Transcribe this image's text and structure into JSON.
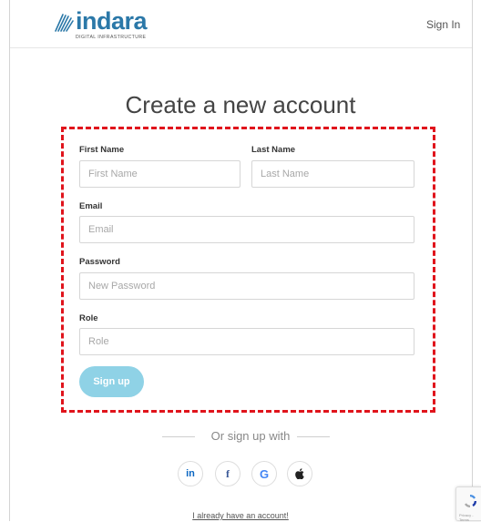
{
  "header": {
    "logo_text": "indara",
    "logo_tagline": "DIGITAL INFRASTRUCTURE",
    "sign_in_label": "Sign In"
  },
  "page": {
    "title": "Create a new account"
  },
  "form": {
    "first_name": {
      "label": "First Name",
      "placeholder": "First Name",
      "value": ""
    },
    "last_name": {
      "label": "Last Name",
      "placeholder": "Last Name",
      "value": ""
    },
    "email": {
      "label": "Email",
      "placeholder": "Email",
      "value": ""
    },
    "password": {
      "label": "Password",
      "placeholder": "New Password",
      "value": ""
    },
    "role": {
      "label": "Role",
      "placeholder": "Role",
      "value": ""
    },
    "submit_label": "Sign up"
  },
  "social": {
    "divider_text": "Or sign up with",
    "providers": [
      {
        "name": "linkedin",
        "glyph": "in",
        "icon": "linkedin-icon",
        "color": "#0a66c2"
      },
      {
        "name": "facebook",
        "glyph": "f",
        "icon": "facebook-icon",
        "color": "#3b5998"
      },
      {
        "name": "google",
        "glyph": "G",
        "icon": "google-icon",
        "color": "#4285f4"
      },
      {
        "name": "apple",
        "glyph": "",
        "icon": "apple-icon",
        "color": "#222222"
      }
    ]
  },
  "footer": {
    "login_link": "I already have an account!",
    "recaptcha_text": "Privacy - Terms"
  },
  "colors": {
    "brand": "#2b78a8",
    "button": "#8fd2e6",
    "highlight": "#e0141c"
  }
}
